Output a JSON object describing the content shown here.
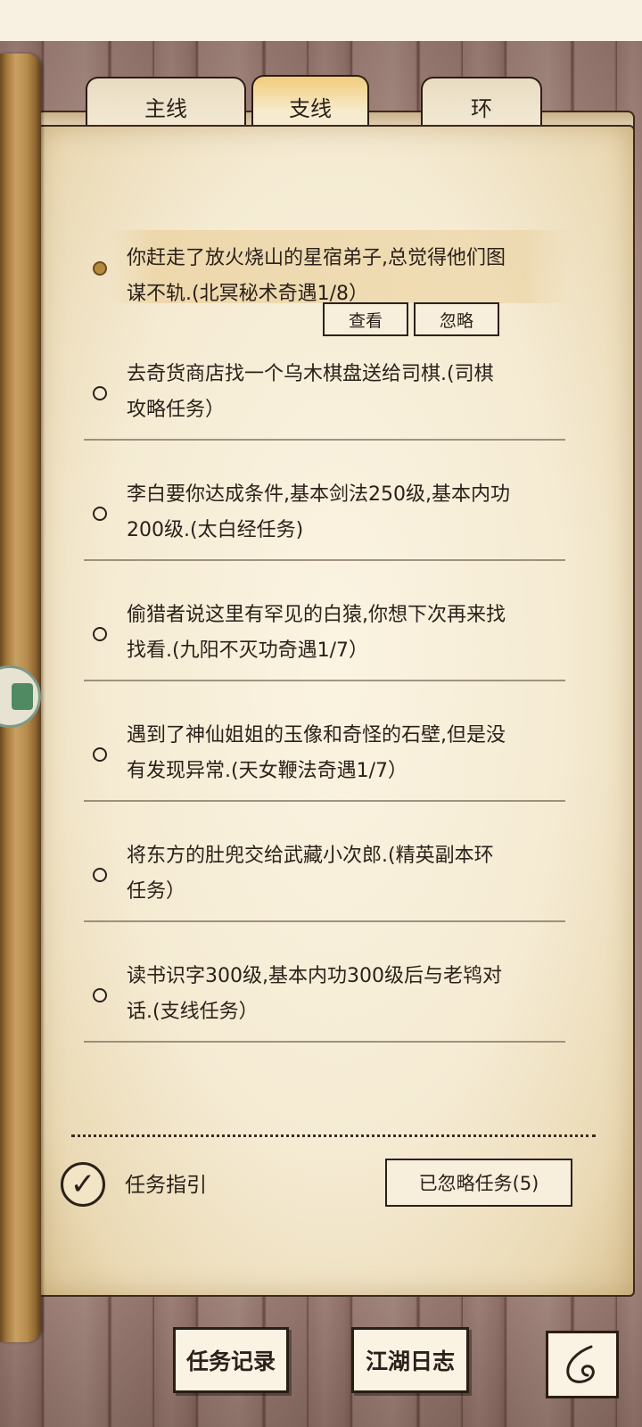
{
  "tabs": [
    {
      "label": "主线",
      "active": false
    },
    {
      "label": "支线",
      "active": true
    },
    {
      "label": "环",
      "active": false
    }
  ],
  "quests": [
    {
      "line1": "你赶走了放火烧山的星宿弟子,总觉得他们图",
      "line2": "谋不轨.(北冥秘术奇遇1/8）",
      "selected": true
    },
    {
      "line1": "去奇货商店找一个乌木棋盘送给司棋.(司棋",
      "line2": "攻略任务）",
      "selected": false
    },
    {
      "line1": "李白要你达成条件,基本剑法250级,基本内功",
      "line2": "200级.(太白经任务)",
      "selected": false
    },
    {
      "line1": "偷猎者说这里有罕见的白猿,你想下次再来找",
      "line2": "找看.(九阳不灭功奇遇1/7）",
      "selected": false
    },
    {
      "line1": "遇到了神仙姐姐的玉像和奇怪的石壁,但是没",
      "line2": "有发现异常.(天女鞭法奇遇1/7）",
      "selected": false
    },
    {
      "line1": "将东方的肚兜交给武藏小次郎.(精英副本环",
      "line2": "任务）",
      "selected": false
    },
    {
      "line1": "读书识字300级,基本内功300级后与老鸨对",
      "line2": "话.(支线任务）",
      "selected": false
    }
  ],
  "selected_actions": {
    "view": "查看",
    "ignore": "忽略"
  },
  "footer": {
    "guide_label": "任务指引",
    "guide_checked": true,
    "ignored_button": "已忽略任务(5)"
  },
  "bottom": {
    "record": "任务记录",
    "journal": "江湖日志",
    "back_icon": "back-swirl-icon"
  },
  "colors": {
    "selected_bullet": "#b58a3c",
    "active_tab": "#f1cd7c"
  }
}
